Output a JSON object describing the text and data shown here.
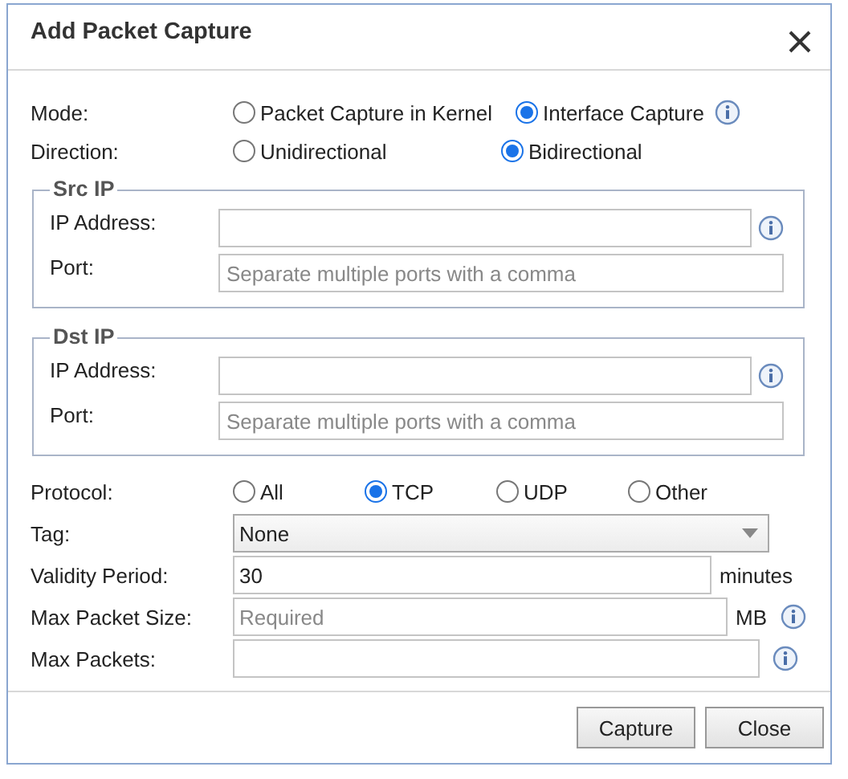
{
  "dialog": {
    "title": "Add Packet Capture"
  },
  "radio_groups": [
    {
      "label": "Mode:",
      "kind": "wide",
      "options": [
        {
          "label": "Packet Capture in Kernel",
          "selected": false
        },
        {
          "label": "Interface Capture",
          "selected": true,
          "info": true
        }
      ]
    },
    {
      "label": "Direction:",
      "kind": "mid",
      "options": [
        {
          "label": "Unidirectional",
          "selected": false
        },
        {
          "label": "Bidirectional",
          "selected": true
        }
      ]
    }
  ],
  "fieldsets": [
    {
      "legend": "Src IP",
      "fields": [
        {
          "label": "IP Address:",
          "info": true
        },
        {
          "label": "Port:",
          "placeholder": "Separate multiple ports with a comma"
        }
      ]
    },
    {
      "legend": "Dst IP",
      "fields": [
        {
          "label": "IP Address:",
          "info": true
        },
        {
          "label": "Port:",
          "placeholder": "Separate multiple ports with a comma"
        }
      ]
    }
  ],
  "protocol": {
    "label": "Protocol:",
    "kind": "narrow",
    "options": [
      {
        "label": "All",
        "selected": false
      },
      {
        "label": "TCP",
        "selected": true
      },
      {
        "label": "UDP",
        "selected": false
      },
      {
        "label": "Other",
        "selected": false
      }
    ]
  },
  "tag": {
    "label": "Tag:",
    "value": "None"
  },
  "fields": [
    {
      "label": "Validity Period:",
      "value": "30",
      "unit": "minutes"
    },
    {
      "label": "Max Packet Size:",
      "placeholder": "Required",
      "unit": "MB",
      "info": true
    },
    {
      "label": "Max Packets:",
      "info": true
    }
  ],
  "buttons": [
    "Capture",
    "Close"
  ]
}
